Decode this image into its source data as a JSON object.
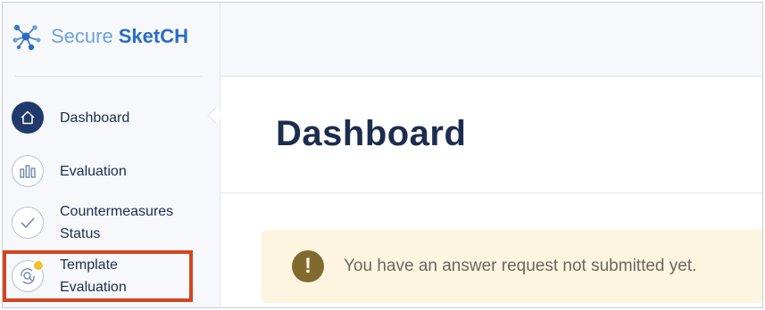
{
  "brand": {
    "name_part1": "Secure",
    "name_part2": "SketCH"
  },
  "sidebar": {
    "items": [
      {
        "label": "Dashboard",
        "icon": "home-icon",
        "active": true
      },
      {
        "label": "Evaluation",
        "icon": "bar-chart-icon",
        "active": false
      },
      {
        "label": "Countermeasures Status",
        "icon": "check-icon",
        "active": false
      },
      {
        "label": "Template Evaluation",
        "icon": "template-search-icon",
        "active": false,
        "badge": true
      }
    ]
  },
  "main": {
    "title": "Dashboard",
    "alert": {
      "icon": "exclamation-icon",
      "text": "You have an answer request not submitted yet."
    }
  },
  "colors": {
    "accent": "#1f3a6b",
    "brand_light": "#6aa3e0",
    "brand_dark": "#2a6bc4",
    "alert_bg": "#fdf5df",
    "alert_icon": "#806a2f",
    "badge": "#f3c12d",
    "highlight": "#d4451f"
  }
}
